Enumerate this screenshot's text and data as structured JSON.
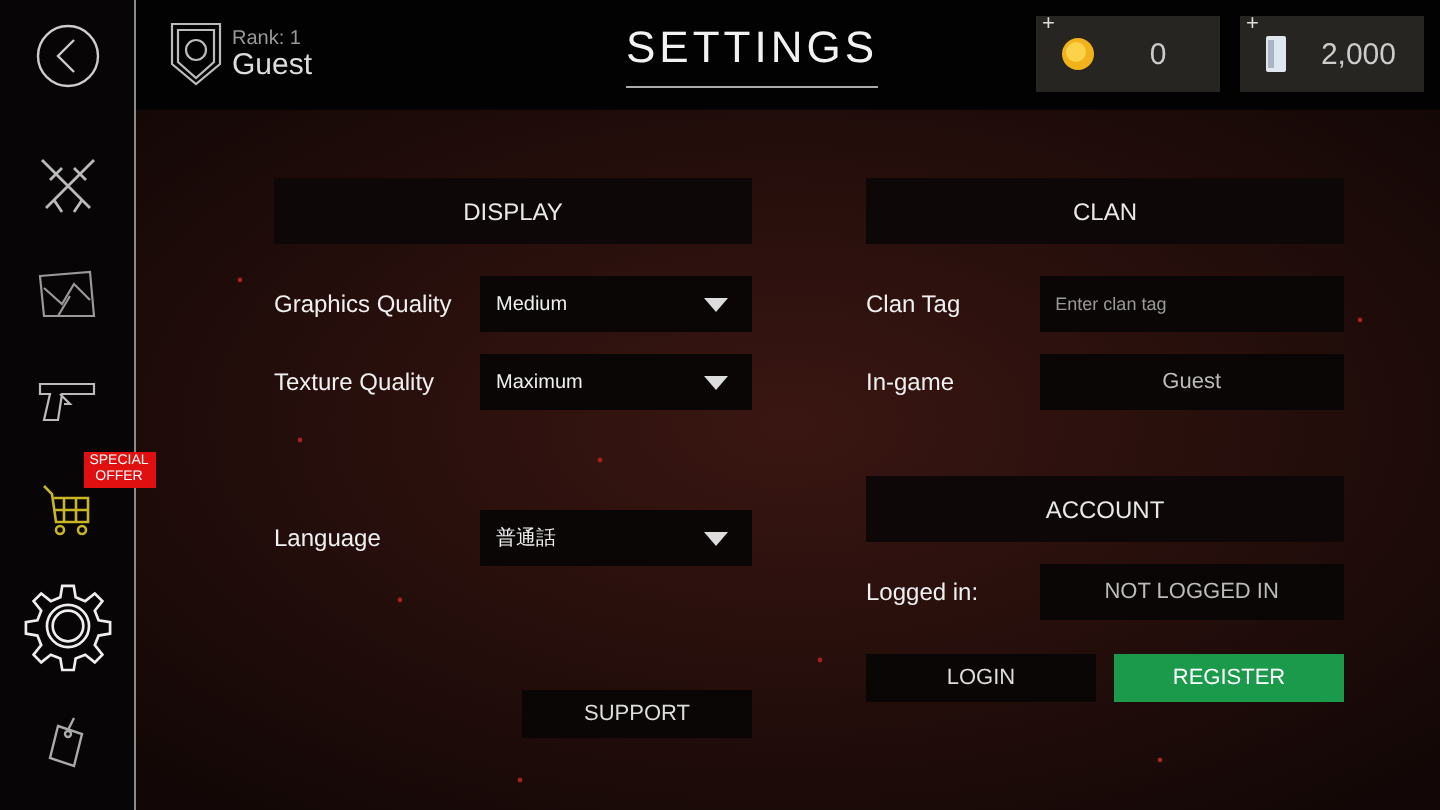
{
  "sidebar": {
    "items": [
      {
        "kind": "swords",
        "selected": false
      },
      {
        "kind": "map",
        "selected": false
      },
      {
        "kind": "pistol",
        "selected": false
      },
      {
        "kind": "cart",
        "selected": false,
        "badge": "SPECIAL OFFER"
      },
      {
        "kind": "gear",
        "selected": true
      },
      {
        "kind": "tag",
        "selected": false
      }
    ]
  },
  "profile": {
    "rank": "Rank: 1",
    "name": "Guest"
  },
  "title": "SETTINGS",
  "currencies": [
    {
      "kind": "coin",
      "plus": "+",
      "amount": "0"
    },
    {
      "kind": "card",
      "plus": "+",
      "amount": "2,000"
    }
  ],
  "display": {
    "header": "DISPLAY",
    "rows": [
      {
        "label": "Graphics Quality",
        "value": "Medium"
      },
      {
        "label": "Texture Quality",
        "value": "Maximum"
      },
      {
        "label": "Language",
        "value": "普通話"
      }
    ],
    "support": "SUPPORT"
  },
  "clan": {
    "header": "CLAN",
    "tag_label": "Clan Tag",
    "tag_placeholder": "Enter clan tag",
    "ingame_label": "In-game",
    "ingame_value": "Guest"
  },
  "account": {
    "header": "ACCOUNT",
    "logged_label": "Logged in:",
    "logged_value": "NOT LOGGED IN",
    "login": "LOGIN",
    "register": "REGISTER"
  }
}
